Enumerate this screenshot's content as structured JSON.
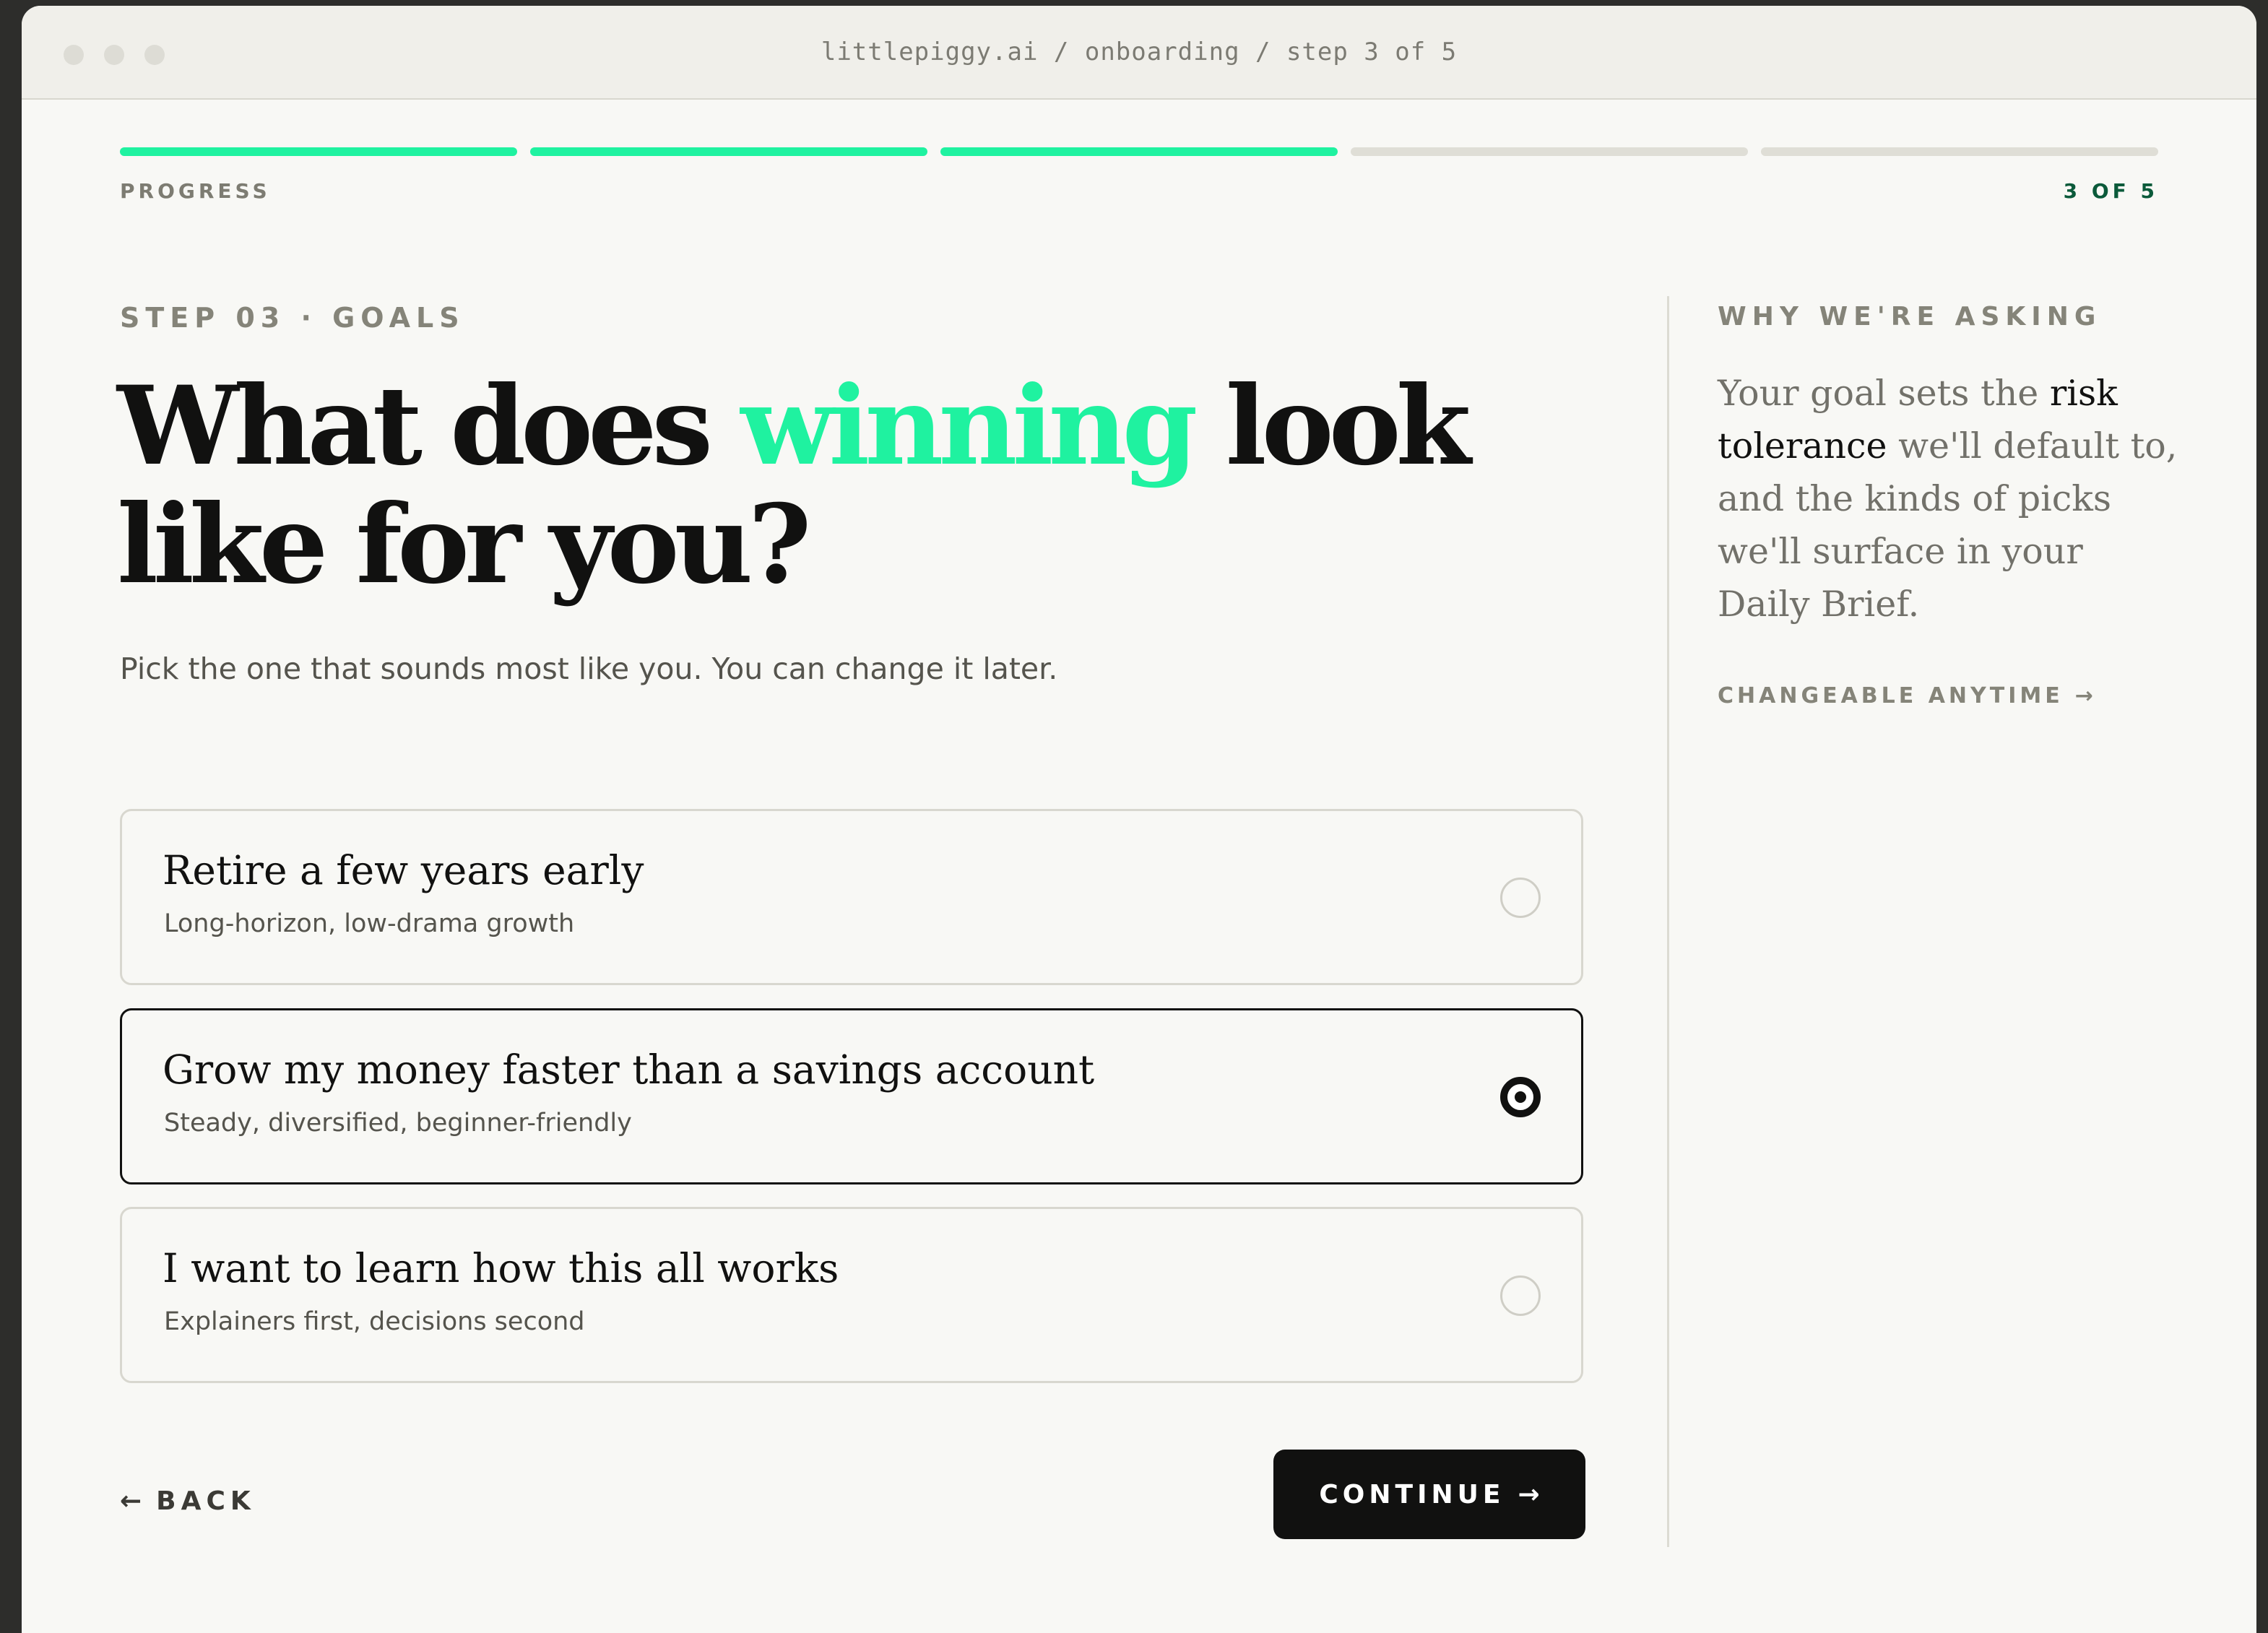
{
  "browser": {
    "url": "littlepiggy.ai / onboarding / step 3 of 5"
  },
  "progress": {
    "label": "PROGRESS",
    "count": "3 OF 5",
    "completed_steps": 3,
    "total_steps": 5,
    "accent_color": "#1ff2a0"
  },
  "step": {
    "label": "STEP 03 · GOALS",
    "headline_before": "What does ",
    "headline_accent": "winning",
    "headline_after": " look like for you?",
    "subtitle": "Pick the one that sounds most like you. You can change it later."
  },
  "options": [
    {
      "title": "Retire a few years early",
      "subtitle": "Long-horizon, low-drama growth",
      "selected": false
    },
    {
      "title": "Grow my money faster than a savings account",
      "subtitle": "Steady, diversified, beginner-friendly",
      "selected": true
    },
    {
      "title": "I want to learn how this all works",
      "subtitle": "Explainers first, decisions second",
      "selected": false
    }
  ],
  "actions": {
    "back_icon": "arrow-left-icon",
    "back_label": "BACK",
    "continue_label": "CONTINUE",
    "continue_icon": "arrow-right-icon"
  },
  "sidebar": {
    "title": "WHY WE'RE ASKING",
    "body_before": "Your goal sets the ",
    "body_emphasis": "risk tolerance",
    "body_after": " we'll default to, and the kinds of picks we'll surface in your Daily Brief.",
    "link_label": "CHANGEABLE ANYTIME",
    "link_icon": "arrow-right-icon"
  }
}
